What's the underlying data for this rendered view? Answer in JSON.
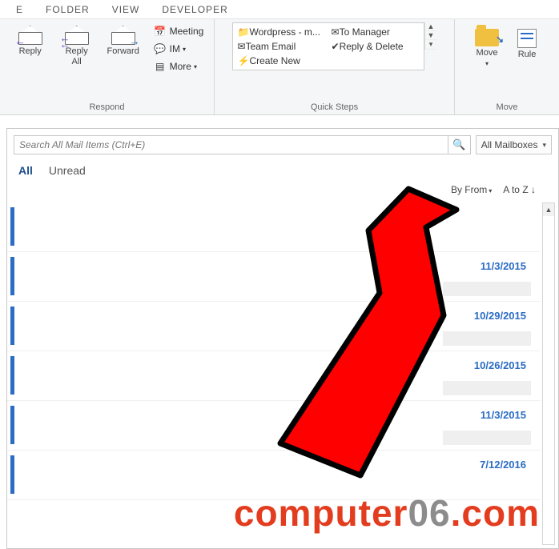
{
  "tabs": {
    "home": "E",
    "folder": "FOLDER",
    "view": "VIEW",
    "developer": "DEVELOPER"
  },
  "ribbon": {
    "respond": {
      "reply": "Reply",
      "reply_all": "Reply\nAll",
      "forward": "Forward",
      "meeting": "Meeting",
      "im": "IM",
      "more": "More",
      "label": "Respond"
    },
    "quicksteps": {
      "wordpress": "Wordpress - m...",
      "team_email": "Team Email",
      "create_new": "Create New",
      "to_manager": "To Manager",
      "reply_delete": "Reply & Delete",
      "label": "Quick Steps"
    },
    "move": {
      "move": "Move",
      "rules": "Rule",
      "label": "Move"
    }
  },
  "search": {
    "placeholder": "Search All Mail Items (Ctrl+E)",
    "scope": "All Mailboxes"
  },
  "filters": {
    "all": "All",
    "unread": "Unread"
  },
  "sort": {
    "by": "By From",
    "order": "A to Z"
  },
  "messages": [
    {
      "date": ""
    },
    {
      "date": "11/3/2015"
    },
    {
      "date": "10/29/2015"
    },
    {
      "date": "10/26/2015"
    },
    {
      "date": "11/3/2015"
    },
    {
      "date": "7/12/2016"
    }
  ],
  "watermark": {
    "a": "computer",
    "b": "06",
    "c": ".com"
  }
}
